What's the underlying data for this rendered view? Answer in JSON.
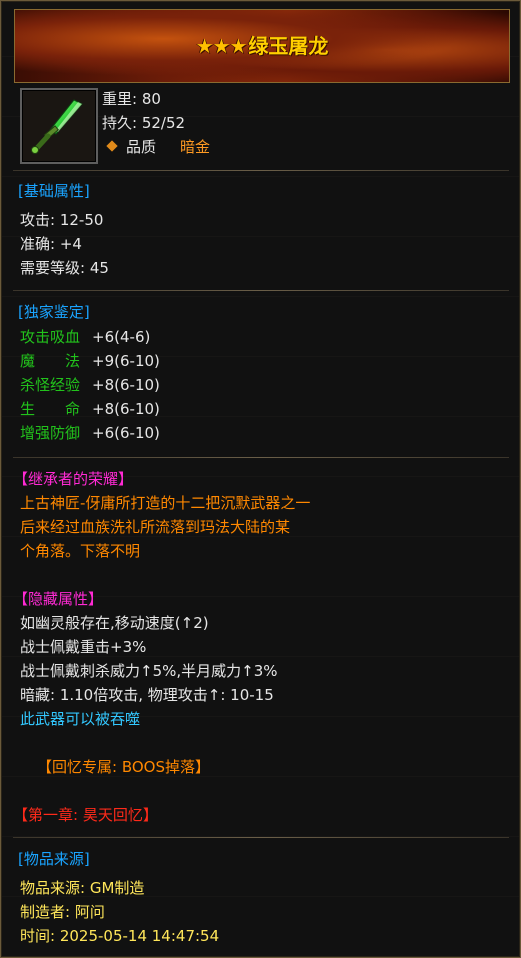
{
  "item": {
    "stars": "★★★",
    "name": "绿玉屠龙",
    "weight": "重里: 80",
    "durability": "持久: 52/52",
    "quality_label": "品质",
    "quality_value": "暗金"
  },
  "basic": {
    "header": "[基础属性]",
    "rows": [
      "攻击: 12-50",
      "准确: +4",
      "需要等级: 45"
    ]
  },
  "unique": {
    "header": "[独家鉴定]",
    "rows": [
      {
        "name": "攻击吸血",
        "value": "+6",
        "range": "(4-6)"
      },
      {
        "name": "魔　　法",
        "value": "+9",
        "range": "(6-10)"
      },
      {
        "name": "杀怪经验",
        "value": "+8",
        "range": "(6-10)"
      },
      {
        "name": "生　　命",
        "value": "+8",
        "range": "(6-10)"
      },
      {
        "name": "增强防御",
        "value": "+6",
        "range": "(6-10)"
      }
    ]
  },
  "honor": {
    "header": "【继承者的荣耀】",
    "lines": [
      "上古神匠-伢庸所打造的十二把沉默武器之一",
      "后来经过血族洗礼所流落到玛法大陆的某",
      "个角落。下落不明"
    ]
  },
  "hidden": {
    "header": "【隐藏属性】",
    "lines": [
      "如幽灵般存在,移动速度(↑2)",
      "战士佩戴重击+3%",
      "战士佩戴刺杀威力↑5%,半月威力↑3%",
      "暗藏: 1.10倍攻击, 物理攻击↑: 10-15"
    ],
    "devour": "此武器可以被吞噬"
  },
  "memory": "【回忆专属: BOOS掉落】",
  "chapter": "【第一章: 昊天回忆】",
  "source": {
    "header": "[物品来源]",
    "origin": "物品来源: GM制造",
    "maker": "制造者: 阿问",
    "time": "时间: 2025-05-14 14:47:54"
  },
  "colors": {
    "title": "#ffd000",
    "section_header": "#1aa4ff",
    "unique_attr": "#22c21c",
    "story_header": "#ff2ad4",
    "story_text": "#ff8800",
    "chapter": "#ff2a1a",
    "devour": "#33c8ff",
    "source_text": "#ffe65a"
  }
}
